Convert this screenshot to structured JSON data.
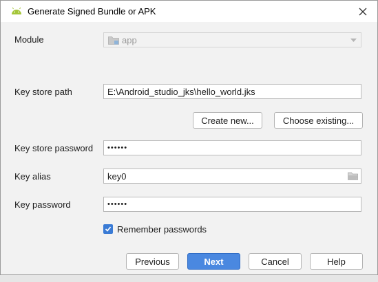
{
  "window": {
    "title": "Generate Signed Bundle or APK"
  },
  "form": {
    "module_label": "Module",
    "module_value": "app",
    "keystore_path_label": "Key store path",
    "keystore_path_value": "E:\\Android_studio_jks\\hello_world.jks",
    "create_new_label": "Create new...",
    "choose_existing_label": "Choose existing...",
    "keystore_password_label": "Key store password",
    "keystore_password_value": "••••••",
    "key_alias_label": "Key alias",
    "key_alias_value": "key0",
    "key_password_label": "Key password",
    "key_password_value": "••••••",
    "remember_label": "Remember passwords",
    "remember_checked": true
  },
  "footer": {
    "previous_label": "Previous",
    "next_label": "Next",
    "cancel_label": "Cancel",
    "help_label": "Help"
  },
  "colors": {
    "accent": "#4a88e0",
    "android_green": "#a4c639"
  }
}
